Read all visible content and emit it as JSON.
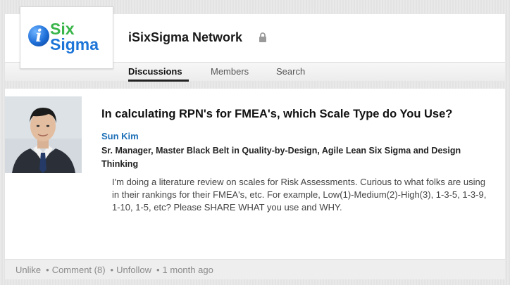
{
  "group": {
    "name": "iSixSigma Network",
    "logo": {
      "letter": "i",
      "line1": "Six",
      "line2": "Sigma"
    }
  },
  "tabs": [
    {
      "label": "Discussions"
    },
    {
      "label": "Members"
    },
    {
      "label": "Search"
    }
  ],
  "post": {
    "title": "In calculating RPN's for FMEA's, which Scale Type do You Use?",
    "author": "Sun Kim",
    "headline": "Sr. Manager, Master Black Belt in Quality-by-Design, Agile Lean Six Sigma and Design Thinking",
    "body": "I'm doing a literature review on scales for Risk Assessments. Curious to what folks are using in their rankings for their FMEA's, etc. For example, Low(1)-Medium(2)-High(3), 1-3-5, 1-3-9, 1-10, 1-5, etc? Please SHARE WHAT you use and WHY."
  },
  "footer": {
    "unlike": "Unlike",
    "comment": "Comment (8)",
    "unfollow": "Unfollow",
    "time": "1 month ago",
    "separator": "•"
  },
  "colors": {
    "link_blue": "#1d6fb6",
    "logo_green": "#39b54a",
    "logo_blue": "#1d75d8"
  },
  "icons": {
    "lock": "lock-icon"
  }
}
